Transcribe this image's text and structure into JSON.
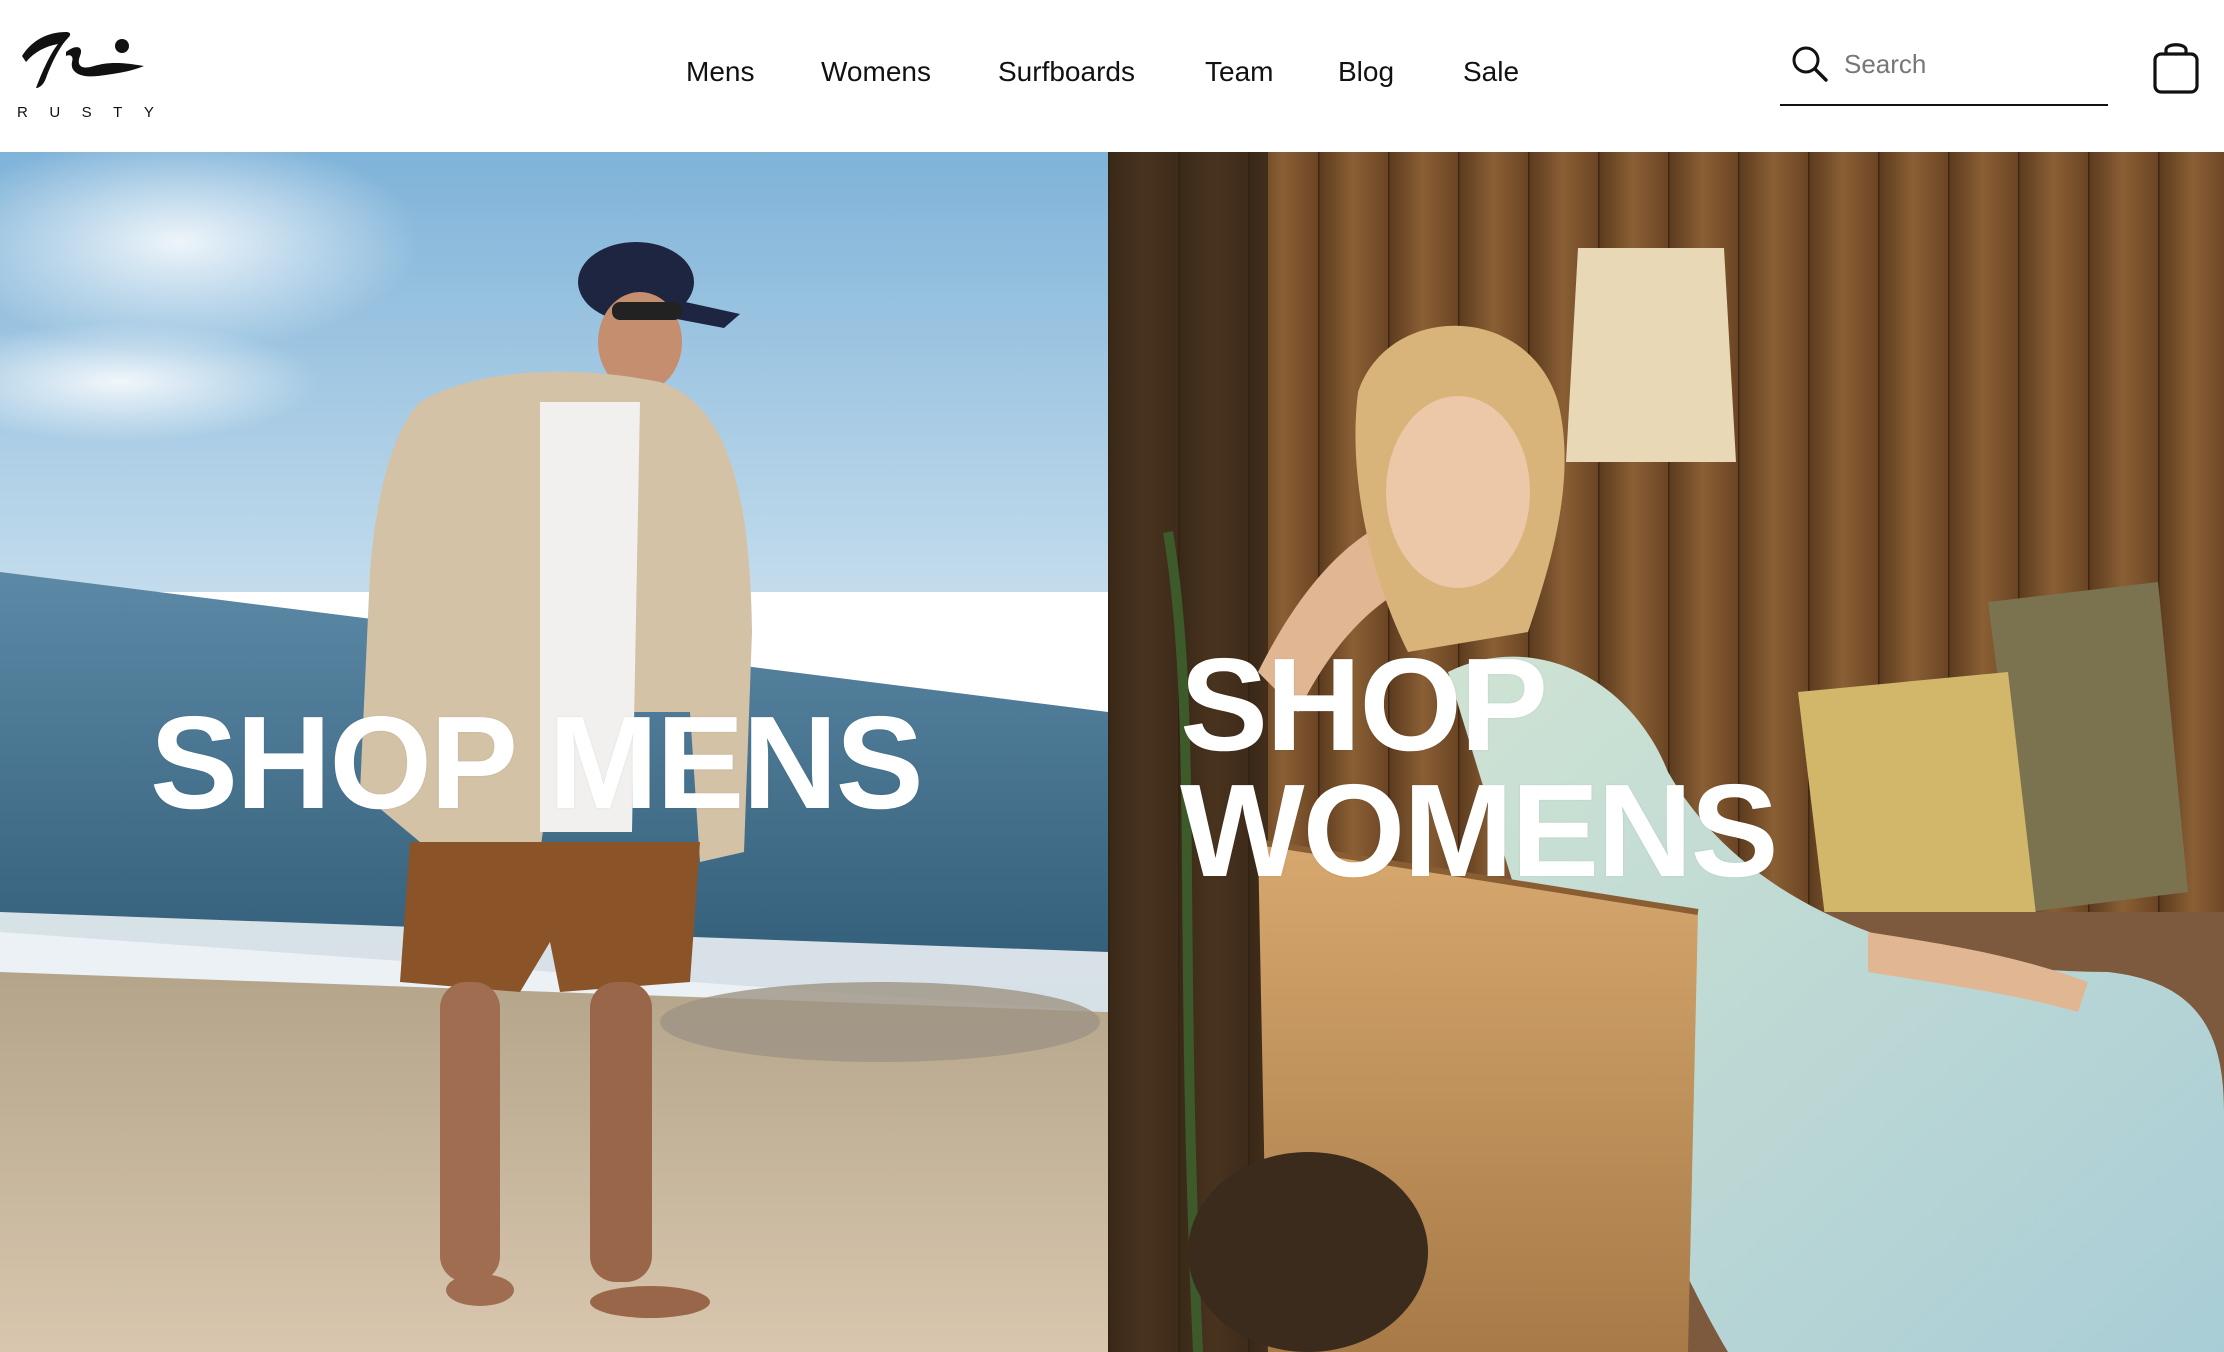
{
  "brand": {
    "name": "RUSTY"
  },
  "nav": {
    "items": [
      {
        "label": "Mens"
      },
      {
        "label": "Womens"
      },
      {
        "label": "Surfboards"
      },
      {
        "label": "Team"
      },
      {
        "label": "Blog"
      },
      {
        "label": "Sale"
      }
    ]
  },
  "search": {
    "placeholder": "Search",
    "value": "",
    "icon": "search-icon"
  },
  "cart": {
    "icon": "shopping-bag-icon"
  },
  "hero": {
    "mens": {
      "cta": "SHOP MENS",
      "image": "man-on-beach-photo"
    },
    "womens": {
      "cta_line1": "SHOP",
      "cta_line2": "WOMENS",
      "image": "woman-on-rattan-sofa-photo"
    }
  },
  "colors": {
    "text": "#111111",
    "background": "#ffffff",
    "cta_text": "#ffffff"
  }
}
